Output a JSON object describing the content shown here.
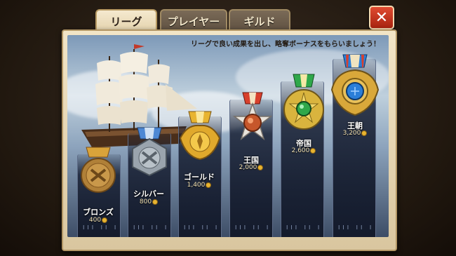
{
  "tabs": [
    {
      "label": "リーグ",
      "active": true
    },
    {
      "label": "プレイヤー",
      "active": false
    },
    {
      "label": "ギルド",
      "active": false
    }
  ],
  "close_icon": "close-x-icon",
  "banner_text": "リーグで良い成果を出し、略奪ボーナスをもらいましょう！",
  "leagues": [
    {
      "name": "ブロンズ",
      "requirement": "400",
      "medal": "bronze-medal-icon",
      "color": "#b08038"
    },
    {
      "name": "シルバー",
      "requirement": "800",
      "medal": "silver-medal-icon",
      "color": "#9aa4ad"
    },
    {
      "name": "ゴールド",
      "requirement": "1,400",
      "medal": "gold-medal-icon",
      "color": "#e0a92c"
    },
    {
      "name": "王国",
      "requirement": "2,000",
      "medal": "kingdom-medal-icon",
      "color": "#d8402c"
    },
    {
      "name": "帝国",
      "requirement": "2,600",
      "medal": "empire-medal-icon",
      "color": "#2fa84a"
    },
    {
      "name": "王朝",
      "requirement": "3,200",
      "medal": "dynasty-medal-icon",
      "color": "#2a7ed8"
    }
  ],
  "tick_marks": "III II I",
  "colors": {
    "accent": "#e04b31",
    "parchment": "#f2e5c7",
    "gold": "#e8b431"
  }
}
